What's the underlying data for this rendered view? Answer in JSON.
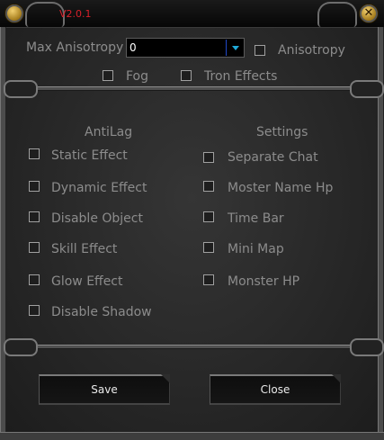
{
  "window": {
    "version": "V2.0.1"
  },
  "graphics": {
    "max_anisotropy_label": "Max Anisotropy",
    "max_anisotropy_value": "0",
    "anisotropy_label": "Anisotropy",
    "fog_label": "Fog",
    "tron_effects_label": "Tron Effects"
  },
  "antilag": {
    "heading": "AntiLag",
    "items": [
      {
        "label": "Static Effect",
        "checked": false
      },
      {
        "label": "Dynamic Effect",
        "checked": false
      },
      {
        "label": "Disable Object",
        "checked": false
      },
      {
        "label": "Skill Effect",
        "checked": false
      },
      {
        "label": "Glow Effect",
        "checked": false
      },
      {
        "label": "Disable Shadow",
        "checked": false
      }
    ]
  },
  "settings": {
    "heading": "Settings",
    "items": [
      {
        "label": "Separate Chat",
        "checked": false
      },
      {
        "label": "Moster Name Hp",
        "checked": false
      },
      {
        "label": "Time Bar",
        "checked": false
      },
      {
        "label": "Mini Map",
        "checked": false
      },
      {
        "label": "Monster HP",
        "checked": false
      }
    ]
  },
  "buttons": {
    "save_label": "Save",
    "close_label": "Close"
  },
  "colors": {
    "version_text": "#d8202a",
    "dropdown_arrow": "#1fa9d8"
  },
  "icons": {
    "left_orb": "gold-orb-icon",
    "close": "close-icon"
  }
}
